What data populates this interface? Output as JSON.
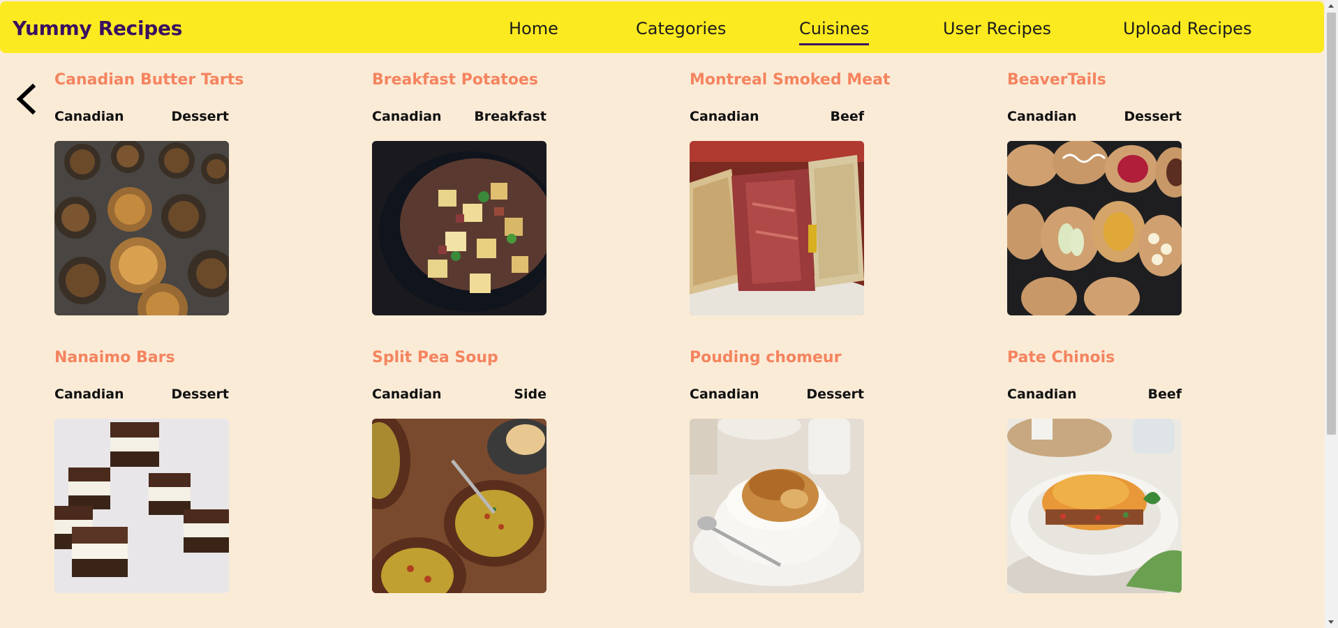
{
  "header": {
    "brand": "Yummy Recipes",
    "nav": [
      {
        "label": "Home"
      },
      {
        "label": "Categories"
      },
      {
        "label": "Cuisines"
      },
      {
        "label": "User Recipes"
      },
      {
        "label": "Upload Recipes"
      }
    ],
    "active_nav": "Cuisines"
  },
  "back_button": {
    "icon": "chevron-left-icon"
  },
  "recipes": [
    {
      "title": "Canadian Butter Tarts",
      "area": "Canadian",
      "category": "Dessert"
    },
    {
      "title": "Breakfast Potatoes",
      "area": "Canadian",
      "category": "Breakfast"
    },
    {
      "title": "Montreal Smoked Meat",
      "area": "Canadian",
      "category": "Beef"
    },
    {
      "title": "BeaverTails",
      "area": "Canadian",
      "category": "Dessert"
    },
    {
      "title": "Nanaimo Bars",
      "area": "Canadian",
      "category": "Dessert"
    },
    {
      "title": "Split Pea Soup",
      "area": "Canadian",
      "category": "Side"
    },
    {
      "title": "Pouding chomeur",
      "area": "Canadian",
      "category": "Dessert"
    },
    {
      "title": "Pate Chinois",
      "area": "Canadian",
      "category": "Beef"
    }
  ],
  "colors": {
    "header_bg": "#fbea20",
    "brand": "#3a1060",
    "page_bg": "#faebd7",
    "recipe_title": "#f4845f"
  }
}
